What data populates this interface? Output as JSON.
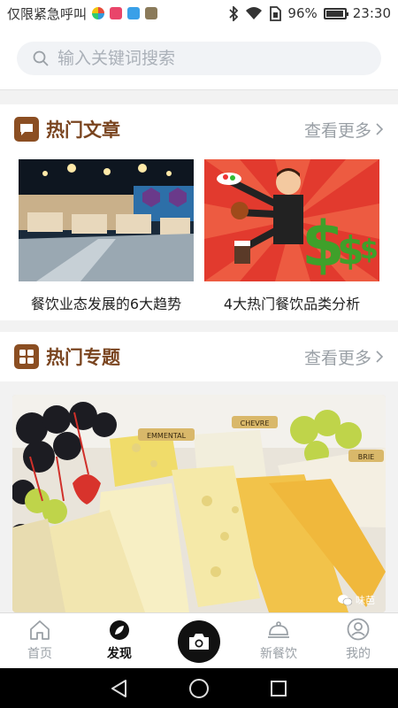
{
  "status_bar": {
    "emergency_text": "仅限紧急呼叫",
    "battery_percent": "96%",
    "battery_level": 0.96,
    "time": "23:30"
  },
  "search": {
    "placeholder": "输入关键词搜索"
  },
  "hot_articles": {
    "title": "热门文章",
    "more_label": "查看更多",
    "items": [
      {
        "title": "餐饮业态发展的6大趋势"
      },
      {
        "title": "4大热门餐饮品类分析"
      }
    ]
  },
  "hot_topics": {
    "title": "热门专题",
    "more_label": "查看更多",
    "cheese_labels": [
      "EMMENTAL",
      "CHEVRE",
      "BRIE"
    ],
    "watermark": "味芭"
  },
  "bottom_nav": {
    "items": [
      {
        "label": "首页",
        "icon": "home-icon"
      },
      {
        "label": "发现",
        "icon": "discover-icon",
        "active": true
      },
      {
        "label": "",
        "icon": "camera-icon"
      },
      {
        "label": "新餐饮",
        "icon": "cloche-icon"
      },
      {
        "label": "我的",
        "icon": "profile-icon"
      }
    ]
  },
  "colors": {
    "accent_brown": "#7a4520",
    "muted_gray": "#9aa0a6"
  }
}
